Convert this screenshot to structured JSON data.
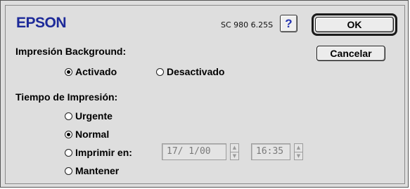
{
  "header": {
    "brand": "EPSON",
    "version": "SC 980 6.25S",
    "help_label": "?"
  },
  "buttons": {
    "ok": "OK",
    "cancel": "Cancelar"
  },
  "background_section": {
    "title": "Impresión Background:",
    "options": [
      {
        "label": "Activado",
        "selected": true
      },
      {
        "label": "Desactivado",
        "selected": false
      }
    ]
  },
  "time_section": {
    "title": "Tiempo de Impresión:",
    "options": [
      {
        "label": "Urgente",
        "selected": false
      },
      {
        "label": "Normal",
        "selected": true
      },
      {
        "label": "Imprimir en:",
        "selected": false
      },
      {
        "label": "Mantener",
        "selected": false
      }
    ],
    "date_value": "17/ 1/00",
    "time_value": "16:35",
    "step_up": "▲",
    "step_down": "▼"
  }
}
